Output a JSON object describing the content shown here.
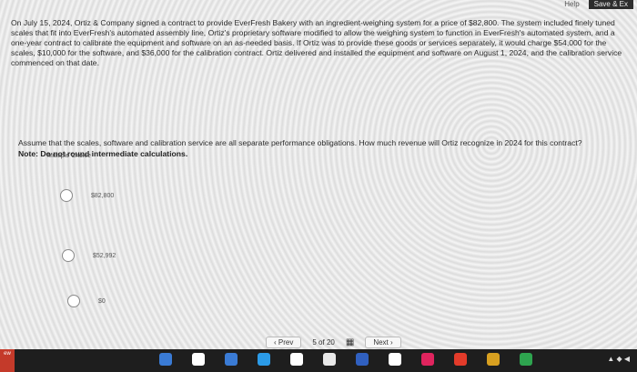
{
  "topbar": {
    "help": "Help",
    "save": "Save & Ex"
  },
  "question": {
    "paragraph": "On July 15, 2024, Ortiz & Company signed a contract to provide EverFresh Bakery with an ingredient-weighing system for a price of $82,800. The system included finely tuned scales that fit into EverFresh's automated assembly line, Ortiz's proprietary software modified to allow the weighing system to function in EverFresh's automated system, and a one-year contract to calibrate the equipment and software on an as-needed basis. If Ortiz was to provide these goods or services separately, it would charge $54,000 for the scales, $10,000 for the software, and $36,000 for the calibration contract. Ortiz delivered and installed the equipment and software on August 1, 2024, and the calibration service commenced on that date.",
    "prompt": "Assume that the scales, software and calibration service are all separate performance obligations. How much revenue will Ortiz recognize in 2024 for this contract?",
    "note": "Note: Do not round intermediate calculations."
  },
  "choice_label": "Multiple Choice",
  "options": [
    "$82,800",
    "$52,992",
    "$0"
  ],
  "nav": {
    "prev": "Prev",
    "page_current": "5",
    "page_of": "of",
    "page_total": "20",
    "next": "Next"
  },
  "taskbar": {
    "left_badge": "ew",
    "colors": [
      "#3a7bd5",
      "#ffffff",
      "#3a7bd5",
      "#2b9be8",
      "#ffffff",
      "#e8e8e8",
      "#3060c0",
      "#ffffff",
      "#e0245e",
      "#e33b2a",
      "#d8a020",
      "#2ea44f"
    ]
  }
}
